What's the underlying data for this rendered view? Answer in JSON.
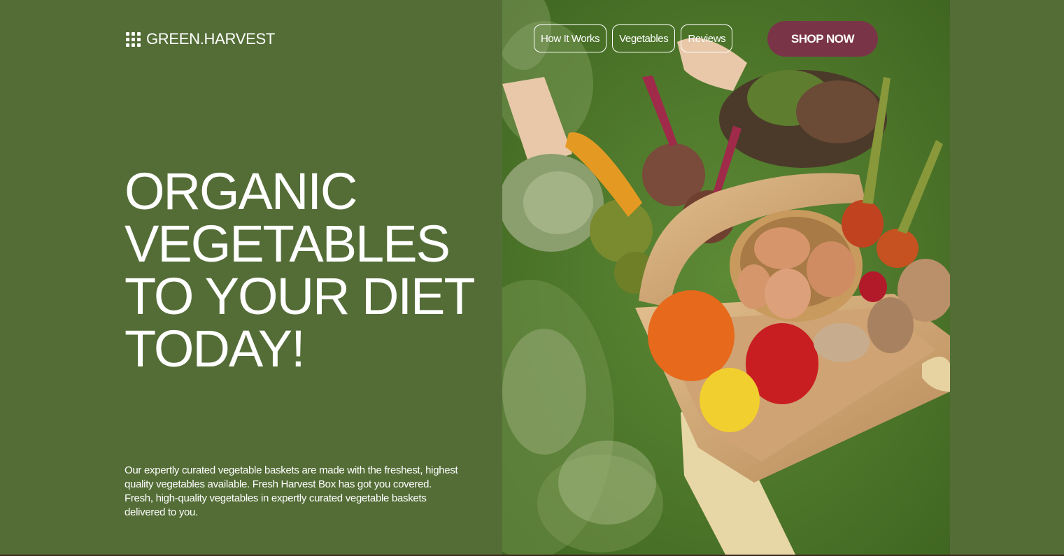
{
  "brand": {
    "name": "GREEN.HARVEST",
    "icon": "grid-icon"
  },
  "nav": {
    "links": [
      "How It Works",
      "Vegetables",
      "Reviews"
    ],
    "cta": "SHOP NOW"
  },
  "hero": {
    "headline_lines": [
      "ORGANIC",
      "VEGETABLES",
      "TO YOUR DIET",
      "TODAY!"
    ],
    "description": "Our expertly curated vegetable baskets are made with the freshest, highest quality vegetables available. Fresh Harvest Box has got you covered. Fresh, high-quality vegetables in expertly curated vegetable baskets delivered to you."
  },
  "colors": {
    "background": "#546d37",
    "accent": "#7a3447",
    "text": "#ffffff"
  }
}
